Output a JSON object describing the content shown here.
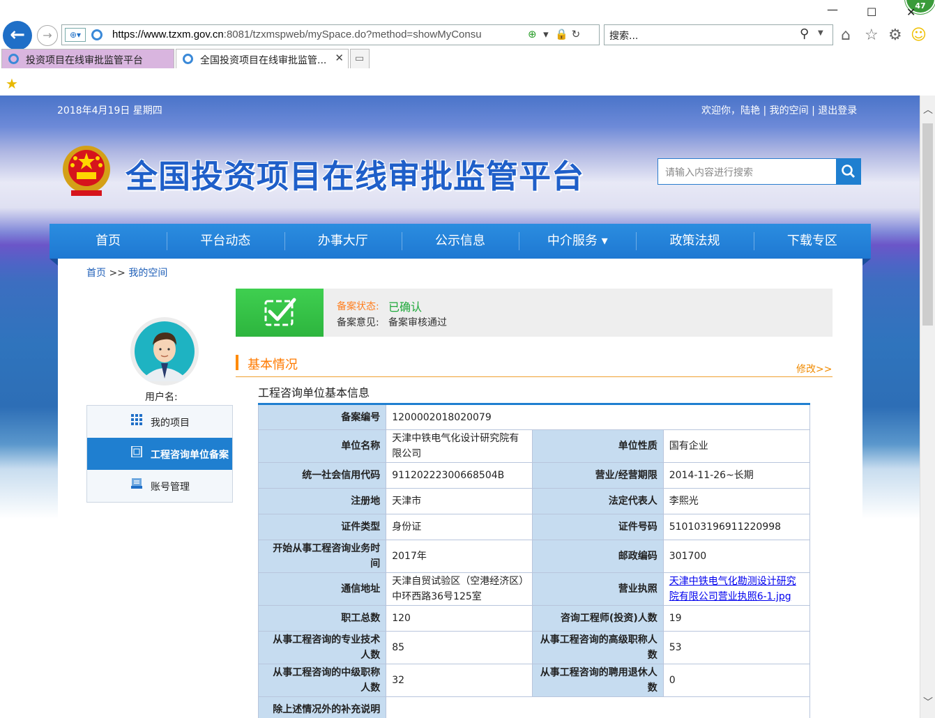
{
  "browser": {
    "url_domain": "https://www.tzxm.gov.cn",
    "url_rest": ":8081/tzxmspweb/mySpace.do?method=showMyConsu",
    "search_placeholder": "搜索...",
    "notification_count": "47",
    "tabs": [
      {
        "label": "投资项目在线审批监管平台"
      },
      {
        "label": "全国投资项目在线审批监管..."
      }
    ]
  },
  "header": {
    "date": "2018年4月19日 星期四",
    "welcome": "欢迎你，",
    "user": "陆艳",
    "sep1": " | ",
    "my_space": "我的空间",
    "sep2": " | ",
    "logout": "退出登录",
    "site_title": "全国投资项目在线审批监管平台",
    "search_placeholder": "请输入内容进行搜索"
  },
  "nav": [
    {
      "label": "首页"
    },
    {
      "label": "平台动态"
    },
    {
      "label": "办事大厅"
    },
    {
      "label": "公示信息"
    },
    {
      "label": "中介服务 ▾"
    },
    {
      "label": "政策法规"
    },
    {
      "label": "下载专区"
    }
  ],
  "breadcrumb": {
    "home": "首页",
    "sep": " >> ",
    "current": "我的空间"
  },
  "sidebar": {
    "username_label": "用户名:",
    "items": [
      {
        "label": "我的项目"
      },
      {
        "label": "工程咨询单位备案"
      },
      {
        "label": "账号管理"
      }
    ]
  },
  "status": {
    "label1": "备案状态:",
    "value1": "已确认",
    "label2": "备案意见:",
    "value2": "备案审核通过"
  },
  "section": {
    "title": "基本情况",
    "modify": "修改>>",
    "subtitle": "工程咨询单位基本信息"
  },
  "table": {
    "record_no_label": "备案编号",
    "record_no": "1200002018020079",
    "unit_name_label": "单位名称",
    "unit_name": "天津中铁电气化设计研究院有限公司",
    "unit_nature_label": "单位性质",
    "unit_nature": "国有企业",
    "credit_code_label": "统一社会信用代码",
    "credit_code": "91120222300668504B",
    "term_label": "营业/经营期限",
    "term": "2014-11-26~长期",
    "reg_place_label": "注册地",
    "reg_place": "天津市",
    "legal_rep_label": "法定代表人",
    "legal_rep": "李熙光",
    "id_type_label": "证件类型",
    "id_type": "身份证",
    "id_no_label": "证件号码",
    "id_no": "510103196911220998",
    "start_time_label": "开始从事工程咨询业务时间",
    "start_time": "2017年",
    "postcode_label": "邮政编码",
    "postcode": "301700",
    "address_label": "通信地址",
    "address": "天津自贸试验区（空港经济区）中环西路36号125室",
    "license_label": "营业执照",
    "license": "天津中铁电气化勘测设计研究院有限公司营业执照6-1.jpg",
    "staff_label": "职工总数",
    "staff": "120",
    "engineers_label": "咨询工程师(投资)人数",
    "engineers": "19",
    "tech_label": "从事工程咨询的专业技术人数",
    "tech": "85",
    "senior_label": "从事工程咨询的高级职称人数",
    "senior": "53",
    "mid_label": "从事工程咨询的中级职称人数",
    "mid": "32",
    "retired_label": "从事工程咨询的聘用退休人数",
    "retired": "0",
    "extra_label": "除上述情况外的补充说明",
    "extra": ""
  }
}
